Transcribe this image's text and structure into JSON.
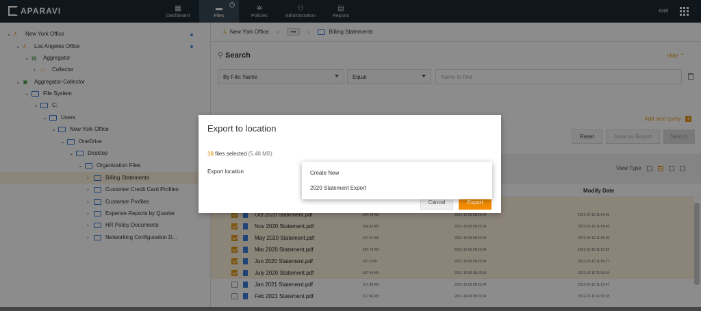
{
  "app": {
    "brand": "APARAVI",
    "user": "root"
  },
  "nav": [
    {
      "label": "Dashboard",
      "icon": "dashboard-icon"
    },
    {
      "label": "Files",
      "icon": "folder-icon",
      "badge": "i"
    },
    {
      "label": "Policies",
      "icon": "gear-icon"
    },
    {
      "label": "Administration",
      "icon": "users-icon"
    },
    {
      "label": "Reports",
      "icon": "report-icon"
    }
  ],
  "tree": [
    {
      "label": "New York Office"
    },
    {
      "label": "Los Angeles Office"
    },
    {
      "label": "Aggregator"
    },
    {
      "label": "Collector"
    },
    {
      "label": "Aggregator-Collector"
    },
    {
      "label": "File System"
    },
    {
      "label": "C:"
    },
    {
      "label": "Users"
    },
    {
      "label": "New York Office"
    },
    {
      "label": "OneDrive"
    },
    {
      "label": "Desktop"
    },
    {
      "label": "Organization Files"
    },
    {
      "label": "Billing Statements"
    },
    {
      "label": "Customer Credit Card Profiles"
    },
    {
      "label": "Customer Profiles"
    },
    {
      "label": "Expense Reports by Quarter"
    },
    {
      "label": "HR Policy Documents"
    },
    {
      "label": "Networking Configuration D..."
    }
  ],
  "breadcrumb": {
    "root": "New York Office",
    "more": "•••",
    "current": "Billing Statements"
  },
  "search": {
    "title": "Search",
    "hide": "Hide",
    "field": "By File: Name",
    "operator": "Equal",
    "placeholder": "Name to find",
    "add_query": "Add next query",
    "reset": "Reset",
    "save": "Save as Report",
    "search": "Search"
  },
  "view": {
    "label": "View Type"
  },
  "table": {
    "header_modify": "Modify Date",
    "rows": [
      {
        "name": "Oct 2020 Statement.pdf",
        "size": "564.78 KB",
        "created": "2021-10-05 08:23:04",
        "modified": "2021-02-10 11:54:59",
        "checked": true
      },
      {
        "name": "Nov 2020 Statement.pdf",
        "size": "564.82 KB",
        "created": "2021-10-05 08:23:04",
        "modified": "2021-02-10 11:54:43",
        "checked": true
      },
      {
        "name": "May 2020 Statement.pdf",
        "size": "567.51 KB",
        "created": "2021-10-05 08:23:04",
        "modified": "2021-02-10 11:56:49",
        "checked": true
      },
      {
        "name": "Mar 2020 Statement.pdf",
        "size": "567.76 KB",
        "created": "2021-10-05 08:23:04",
        "modified": "2021-02-10 11:57:52",
        "checked": true
      },
      {
        "name": "Jun 2020 Statement.pdf",
        "size": "567.5 KB",
        "created": "2021-10-05 08:23:04",
        "modified": "2021-02-10 11:56:27",
        "checked": true
      },
      {
        "name": "July 2020 Statement.pdf",
        "size": "567.44 KB",
        "created": "2021-10-05 08:23:04",
        "modified": "2021-02-10 11:55:54",
        "checked": true
      },
      {
        "name": "Jan 2021 Statement.pdf",
        "size": "517.86 KB",
        "created": "2021-10-05 08:23:04",
        "modified": "2021-02-10 11:53:47",
        "checked": false
      },
      {
        "name": "Feb 2021 Statement.pdf",
        "size": "517.86 KB",
        "created": "2021-10-05 08:23:04",
        "modified": "2021-02-10 11:53:18",
        "checked": false
      }
    ]
  },
  "modal": {
    "title": "Export to location",
    "count": "10",
    "count_text": "files selected",
    "size": "(5.48 MB)",
    "location_label": "Export location",
    "cancel": "Cancel",
    "export": "Export",
    "options": [
      "Create New",
      "2020 Statement Export"
    ]
  },
  "colors": {
    "accent": "#f28c00",
    "topbar": "#1d2b36",
    "selected_row": "#fdf0dc"
  }
}
